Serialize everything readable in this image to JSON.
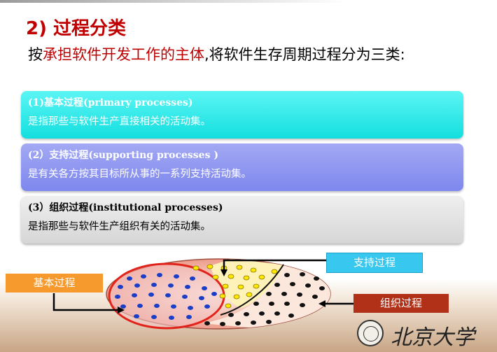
{
  "title": {
    "num": "2)",
    "text": "过程分类"
  },
  "subtitle": {
    "pre": "按",
    "emphasis": "承担软件开发工作的主体",
    "post": ",将软件生存周期过程分为三类:"
  },
  "boxes": [
    {
      "title": "(1)基本过程(primary processes)",
      "desc": "是指那些与软件生产直接相关的活动集。"
    },
    {
      "title": "(2）支持过程(supporting processes )",
      "desc": "是有关各方按其目标所从事的一系列支持活动集。"
    },
    {
      "title": "(3）组织过程(institutional processes)",
      "desc": "是指那些与软件生产组织有关的活动集。"
    }
  ],
  "diagram": {
    "label_primary": "基本过程",
    "label_supporting": "支持过程",
    "label_institutional": "组织过程"
  },
  "logo": {
    "name": "北京大学"
  },
  "colors": {
    "primary_box": "#22e3e3",
    "supporting_box": "#8f96f0",
    "institutional_box": "#e2e2e2",
    "accent": "#c00000"
  }
}
